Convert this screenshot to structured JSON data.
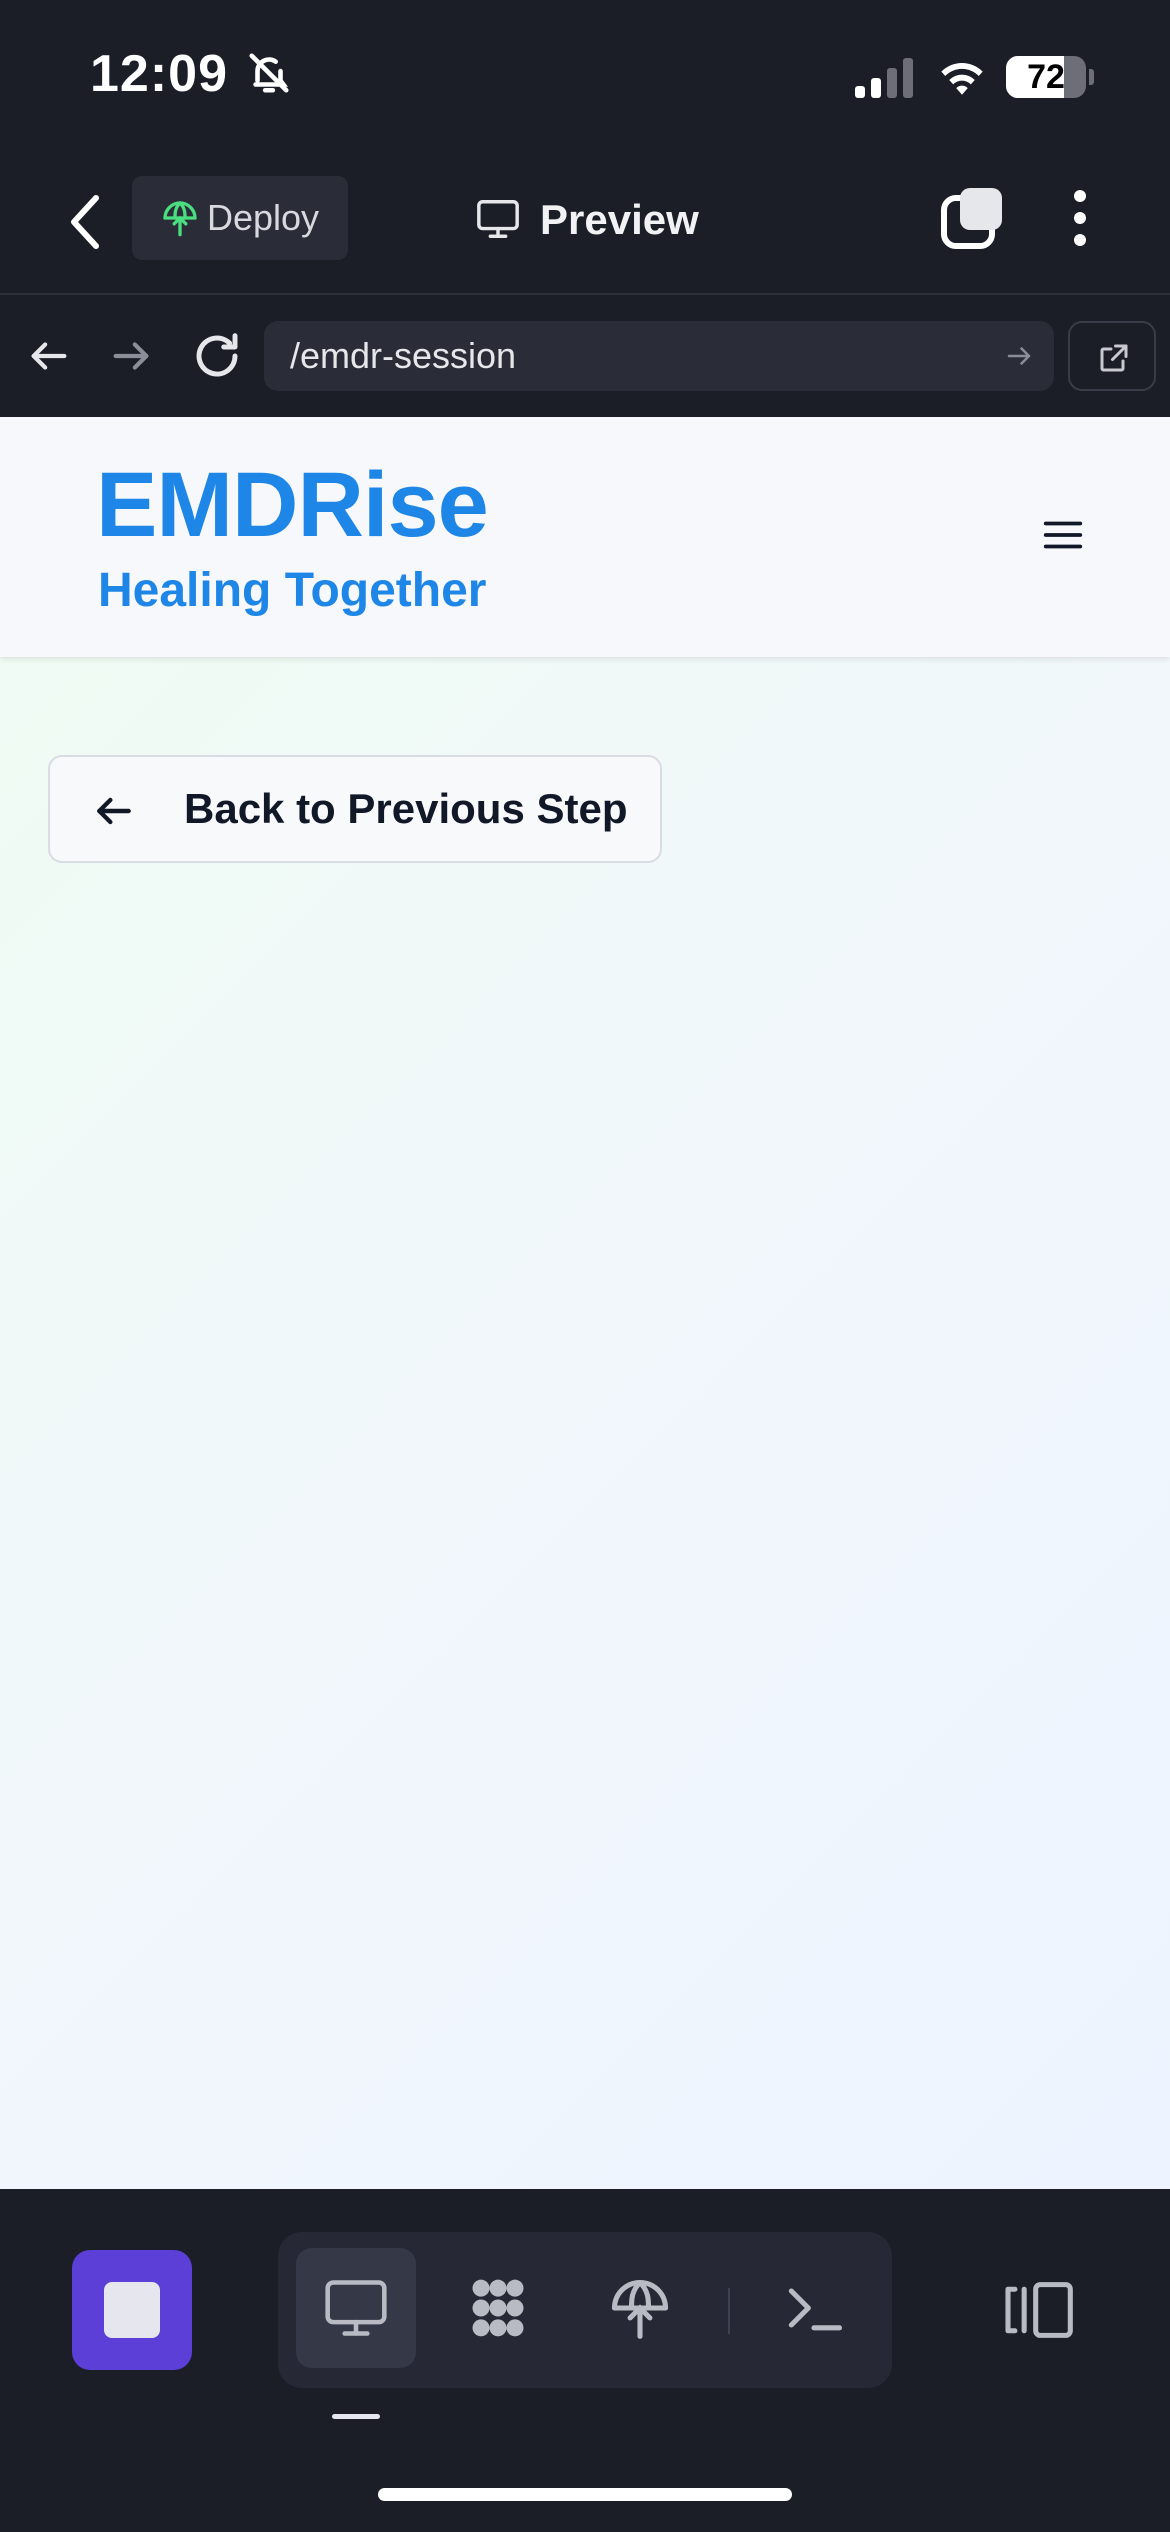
{
  "status_bar": {
    "time": "12:09",
    "battery_percent": "72",
    "battery_level": 0.72,
    "icons": [
      "bell-slash-icon",
      "signal-icon",
      "wifi-icon",
      "battery-icon"
    ]
  },
  "app_bar": {
    "deploy_label": "Deploy",
    "preview_label": "Preview",
    "icons": [
      "chevron-left-icon",
      "deploy-icon",
      "monitor-icon",
      "tabs-icon",
      "more-vertical-icon"
    ]
  },
  "url_bar": {
    "url": "/emdr-session",
    "icons": [
      "arrow-left-icon",
      "arrow-right-icon",
      "reload-icon",
      "arrow-right-small-icon",
      "external-link-icon"
    ]
  },
  "site": {
    "brand_name": "EMDRise",
    "tagline": "Healing Together",
    "back_button_label": "Back to Previous Step",
    "icons": [
      "hamburger-menu-icon",
      "arrow-left-icon"
    ]
  },
  "bottom_bar": {
    "tools": [
      "monitor-icon",
      "apps-icon",
      "deploy-icon",
      "terminal-icon"
    ],
    "icons": [
      "stop-icon",
      "panel-toggle-icon"
    ]
  },
  "colors": {
    "brand_blue": "#1e86e6",
    "dark_bg": "#1b1d27",
    "stop_purple": "#5b3fd6",
    "deploy_green": "#4ade80"
  }
}
